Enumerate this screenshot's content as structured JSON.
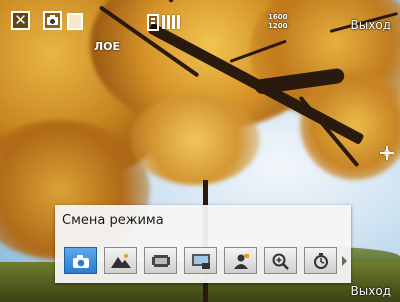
{
  "status_bar": {
    "shot_counter": "ЛОЕ",
    "resolution_top": "1600",
    "resolution_bottom": "1200",
    "exit_label": "Выход"
  },
  "mode_panel": {
    "title": "Смена режима",
    "modes": [
      {
        "icon": "photo-mode-icon",
        "active": true
      },
      {
        "icon": "landscape-icon",
        "active": false
      },
      {
        "icon": "video-icon",
        "active": false
      },
      {
        "icon": "picture-theme-icon",
        "active": false
      },
      {
        "icon": "contact-picture-icon",
        "active": false
      },
      {
        "icon": "zoom-icon",
        "active": false
      },
      {
        "icon": "self-timer-icon",
        "active": false
      }
    ]
  },
  "softkey": {
    "exit_label": "Выход"
  },
  "colors": {
    "active_mode": "#2b7bd0",
    "panel_bg": "#f5f5f5"
  }
}
